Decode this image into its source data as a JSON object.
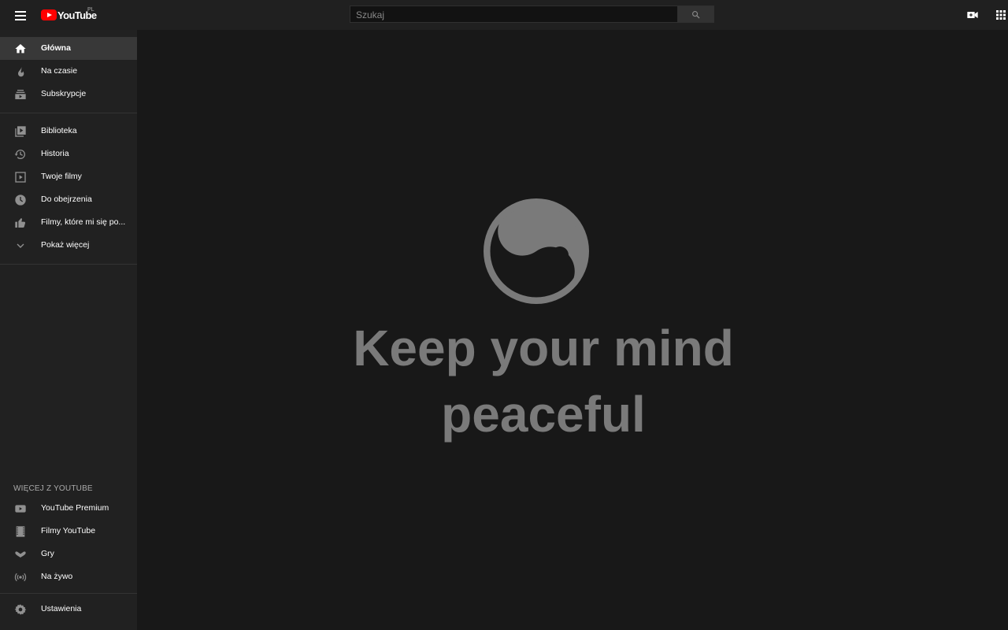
{
  "header": {
    "logo_text": "YouTube",
    "country": "PL",
    "search_placeholder": "Szukaj"
  },
  "sidebar": {
    "primary": [
      {
        "label": "Główna",
        "icon": "home-icon"
      },
      {
        "label": "Na czasie",
        "icon": "trending-icon"
      },
      {
        "label": "Subskrypcje",
        "icon": "subscriptions-icon"
      }
    ],
    "library": [
      {
        "label": "Biblioteka",
        "icon": "library-icon"
      },
      {
        "label": "Historia",
        "icon": "history-icon"
      },
      {
        "label": "Twoje filmy",
        "icon": "your-videos-icon"
      },
      {
        "label": "Do obejrzenia",
        "icon": "watch-later-icon"
      },
      {
        "label": "Filmy, które mi się po...",
        "icon": "liked-icon"
      },
      {
        "label": "Pokaż więcej",
        "icon": "chevron-down-icon"
      }
    ],
    "more_title": "WIĘCEJ Z YOUTUBE",
    "more": [
      {
        "label": "YouTube Premium",
        "icon": "premium-icon"
      },
      {
        "label": "Filmy YouTube",
        "icon": "movies-icon"
      },
      {
        "label": "Gry",
        "icon": "gaming-icon"
      },
      {
        "label": "Na żywo",
        "icon": "live-icon"
      }
    ],
    "settings": [
      {
        "label": "Ustawienia",
        "icon": "gear-icon"
      }
    ]
  },
  "main": {
    "quote_line1": "Keep your mind",
    "quote_line2": "peaceful"
  },
  "colors": {
    "topbar": "#202020",
    "sidebar": "#212121",
    "main_bg": "#181818",
    "quote": "#7a7a7a",
    "brand": "#ff0000"
  }
}
